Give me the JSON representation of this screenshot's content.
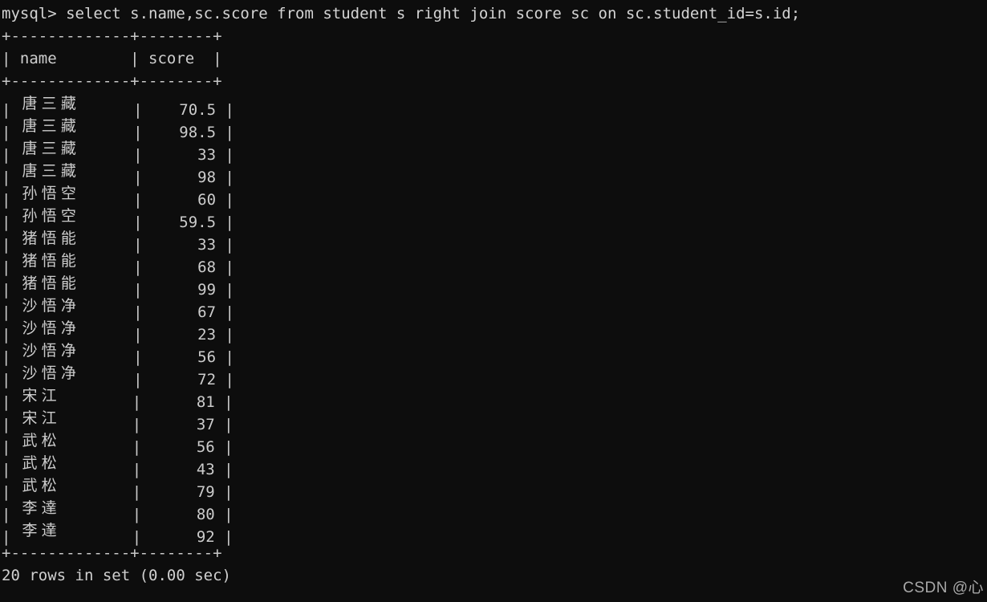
{
  "terminal": {
    "background_color": "#0d0d0d",
    "text_color": "#cccccc",
    "prompt": "mysql> ",
    "command": "select s.name,sc.score from student s right join score sc on sc.student_id=s.id;",
    "command_line": "mysql> select s.name,sc.score from student s right join score sc on sc.student_id=s.id;",
    "status_line": "20 rows in set (0.00 sec)",
    "row_count": 20,
    "elapsed": "0.00 sec"
  },
  "table": {
    "border_line": "+-------------+--------+",
    "header_line": "| name        | score  |",
    "columns": [
      {
        "name": "name",
        "width": 13,
        "align": "left"
      },
      {
        "name": "score",
        "width": 8,
        "align": "right"
      }
    ],
    "headers": [
      "name",
      "score"
    ],
    "rows": [
      {
        "name": "唐三藏",
        "score": "70.5"
      },
      {
        "name": "唐三藏",
        "score": "98.5"
      },
      {
        "name": "唐三藏",
        "score": "33"
      },
      {
        "name": "唐三藏",
        "score": "98"
      },
      {
        "name": "孙悟空",
        "score": "60"
      },
      {
        "name": "孙悟空",
        "score": "59.5"
      },
      {
        "name": "猪悟能",
        "score": "33"
      },
      {
        "name": "猪悟能",
        "score": "68"
      },
      {
        "name": "猪悟能",
        "score": "99"
      },
      {
        "name": "沙悟净",
        "score": "67"
      },
      {
        "name": "沙悟净",
        "score": "23"
      },
      {
        "name": "沙悟净",
        "score": "56"
      },
      {
        "name": "沙悟净",
        "score": "72"
      },
      {
        "name": "宋江",
        "score": "81"
      },
      {
        "name": "宋江",
        "score": "37"
      },
      {
        "name": "武松",
        "score": "56"
      },
      {
        "name": "武松",
        "score": "43"
      },
      {
        "name": "武松",
        "score": "79"
      },
      {
        "name": "李達",
        "score": "80"
      },
      {
        "name": "李達",
        "score": "92"
      }
    ]
  },
  "watermark": {
    "text": "CSDN @心"
  }
}
